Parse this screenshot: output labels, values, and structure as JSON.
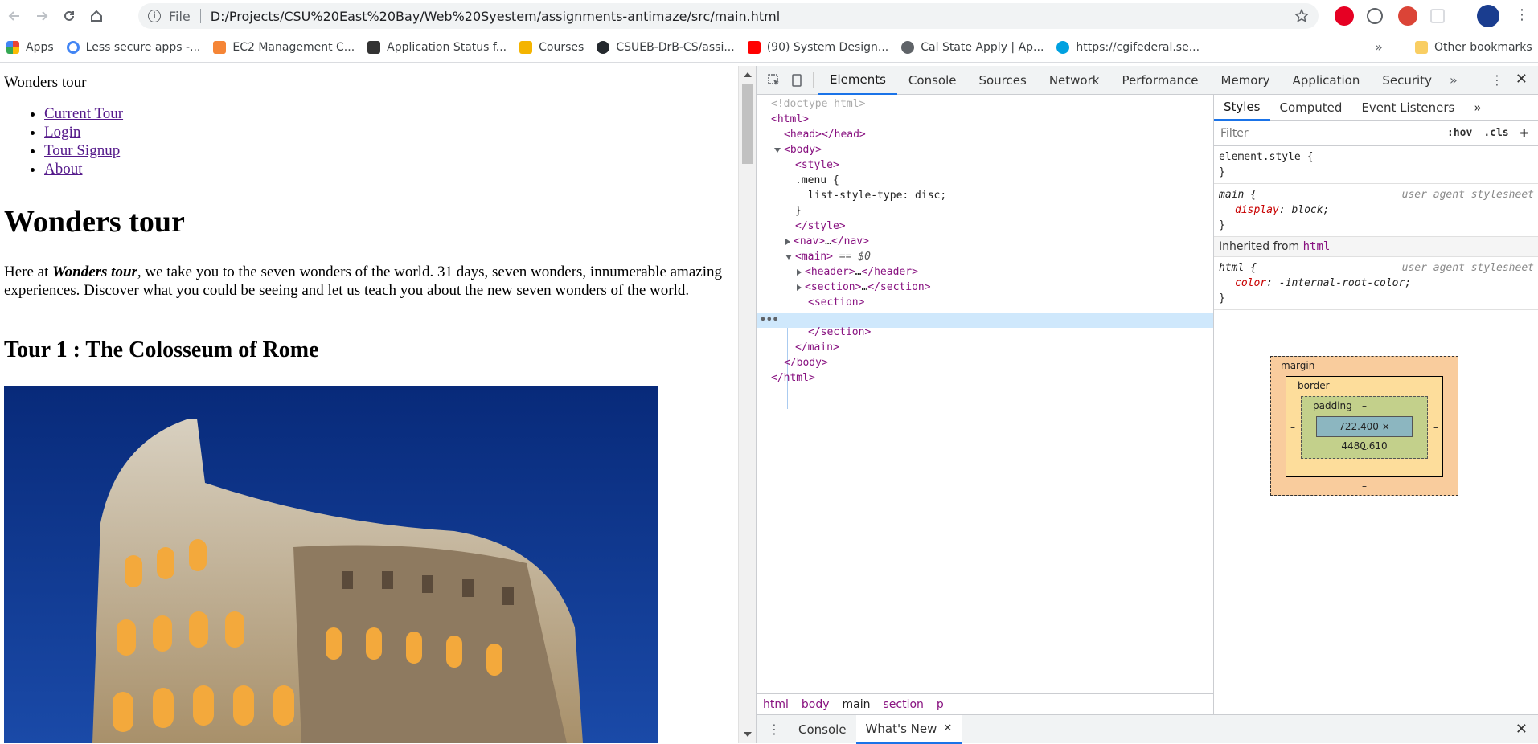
{
  "browser": {
    "scheme": "File",
    "url": "D:/Projects/CSU%20East%20Bay/Web%20Syestem/assignments-antimaze/src/main.html"
  },
  "bookmarks": {
    "items": [
      {
        "label": "Apps",
        "icon": "apps-grid-icon",
        "color": "#ea4335"
      },
      {
        "label": "Less secure apps -...",
        "icon": "google-icon",
        "color": "#4285f4"
      },
      {
        "label": "EC2 Management C...",
        "icon": "aws-icon",
        "color": "#f58536"
      },
      {
        "label": "Application Status f...",
        "icon": "university-icon",
        "color": "#333333"
      },
      {
        "label": "Courses",
        "icon": "pencil-icon",
        "color": "#e8a500"
      },
      {
        "label": "CSUEB-DrB-CS/assi...",
        "icon": "github-icon",
        "color": "#24292e"
      },
      {
        "label": "(90) System Design...",
        "icon": "youtube-icon",
        "color": "#ff0000"
      },
      {
        "label": "Cal State Apply | Ap...",
        "icon": "globe-icon",
        "color": "#5f6368"
      },
      {
        "label": "https://cgifederal.se...",
        "icon": "salesforce-cloud-icon",
        "color": "#00a1e0"
      }
    ],
    "overflow": "»",
    "other": "Other bookmarks"
  },
  "page": {
    "brand": "Wonders tour",
    "menu": [
      "Current Tour",
      "Login",
      "Tour Signup",
      "About"
    ],
    "heading": "Wonders tour",
    "intro_before": "Here at ",
    "intro_bold": "Wonders tour",
    "intro_after": ", we take you to the seven wonders of the world. 31 days, seven wonders, innumerable amazing experiences. Discover what you could be seeing and let us teach you about the new seven wonders of the world.",
    "tour_heading": "Tour 1 : The Colosseum of Rome"
  },
  "devtools": {
    "tabs": [
      "Elements",
      "Console",
      "Sources",
      "Network",
      "Performance",
      "Memory",
      "Application",
      "Security"
    ],
    "active_tab": "Elements",
    "more": "»",
    "dom": {
      "doctype": "<!doctype html>",
      "html_open": "<html>",
      "head": "<head></head>",
      "body_open": "<body>",
      "style_open": "<style>",
      "css_selector": ".menu {",
      "css_decl": "list-style-type: disc;",
      "css_close": "}",
      "style_close": "</style>",
      "nav": "<nav>",
      "nav_ell": "…",
      "nav_close": "</nav>",
      "main_open": "<main>",
      "main_ref": " == $0",
      "header": "<header>",
      "header_ell": "…",
      "header_close": "</header>",
      "section1": "<section>",
      "section1_ell": "…",
      "section1_close": "</section>",
      "section2_open": "<section>",
      "section2_close": "</section>",
      "main_close": "</main>",
      "body_close": "</body>",
      "html_close": "</html>",
      "dots": "•••"
    },
    "breadcrumbs": [
      "html",
      "body",
      "main",
      "section",
      "p"
    ],
    "active_crumb": "main",
    "styles": {
      "tabs": [
        "Styles",
        "Computed",
        "Event Listeners"
      ],
      "active_tab": "Styles",
      "more": "»",
      "filter_placeholder": "Filter",
      "hov": ":hov",
      "cls": ".cls",
      "add": "+",
      "element_style": "element.style {",
      "element_style_close": "}",
      "main_rule_selector": "main {",
      "main_rule_source": "user agent stylesheet",
      "main_rule_prop": "display",
      "main_rule_value": "block;",
      "main_rule_close": "}",
      "inherited_label": "Inherited from ",
      "inherited_tag": "html",
      "html_rule_selector": "html {",
      "html_rule_source": "user agent stylesheet",
      "html_rule_prop": "color",
      "html_rule_value": "-internal-root-color;",
      "html_rule_close": "}"
    },
    "box_model": {
      "margin_label": "margin",
      "border_label": "border",
      "padding_label": "padding",
      "content_size": "722.400 × 4480.610",
      "dash": "–"
    },
    "drawer": {
      "tabs": [
        "Console",
        "What's New"
      ],
      "active_tab": "What's New"
    }
  }
}
